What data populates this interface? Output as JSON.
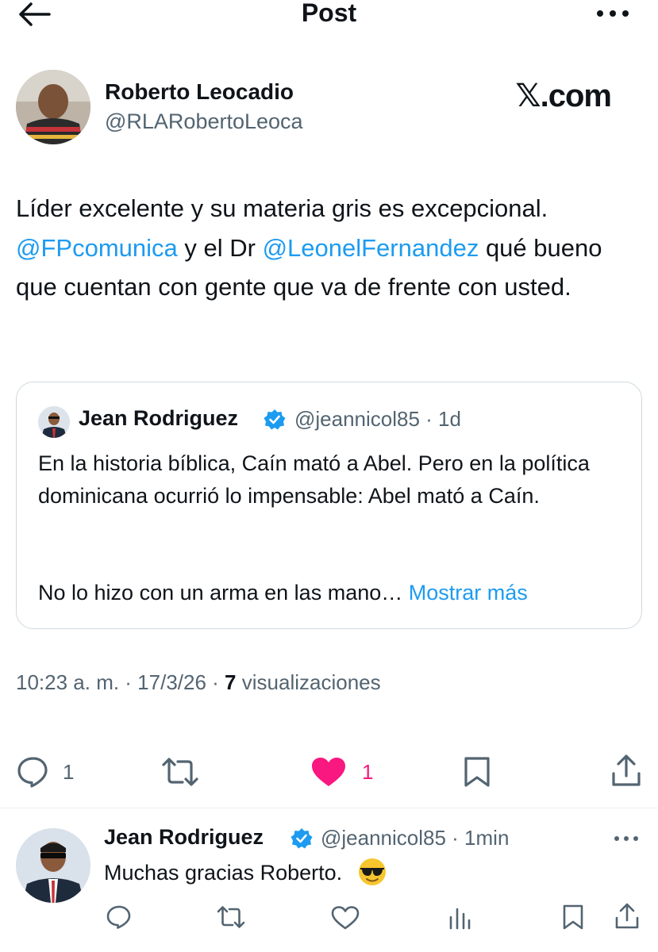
{
  "header": {
    "title": "Post",
    "back_icon": "arrow-left-icon",
    "more_icon": "more-horizontal-icon"
  },
  "author": {
    "name": "Roberto Leocadio",
    "handle": "@RLARobertoLeoca",
    "brand": "𝕏.com"
  },
  "post": {
    "text_1": "Líder excelente y su materia gris es excepcional.",
    "mention_1": "@FPcomunica",
    "text_2": " y el Dr ",
    "mention_2": "@LeonelFernandez",
    "text_3": " qué bueno que cuentan con gente que va de frente con usted."
  },
  "quote": {
    "name": "Jean Rodriguez",
    "meta": "@jeannicol85 · 1d",
    "text": "En la historia bíblica, Caín mató a Abel. Pero en la política dominicana ocurrió lo impensable: Abel mató a Caín.",
    "text_2": "No lo hizo con un arma en las mano…",
    "show_more": "Mostrar más"
  },
  "post_meta": {
    "time": "10:23 a. m. · 17/3/26 ·",
    "views_count": "7",
    "views_label": "visualizaciones"
  },
  "actions": {
    "replies": "1",
    "likes": "1",
    "icons": [
      "reply-icon",
      "retweet-icon",
      "like-icon",
      "bookmark-icon",
      "share-icon"
    ],
    "like_color": "#f91880"
  },
  "reply": {
    "name": "Jean Rodriguez",
    "meta": "@jeannicol85 · 1min",
    "text": "Muchas gracias Roberto.",
    "emoji": "smiling-face-with-sunglasses-icon"
  },
  "colors": {
    "accent": "#1d9bf0",
    "secondary_text": "#536471",
    "border": "#cfd9de"
  }
}
